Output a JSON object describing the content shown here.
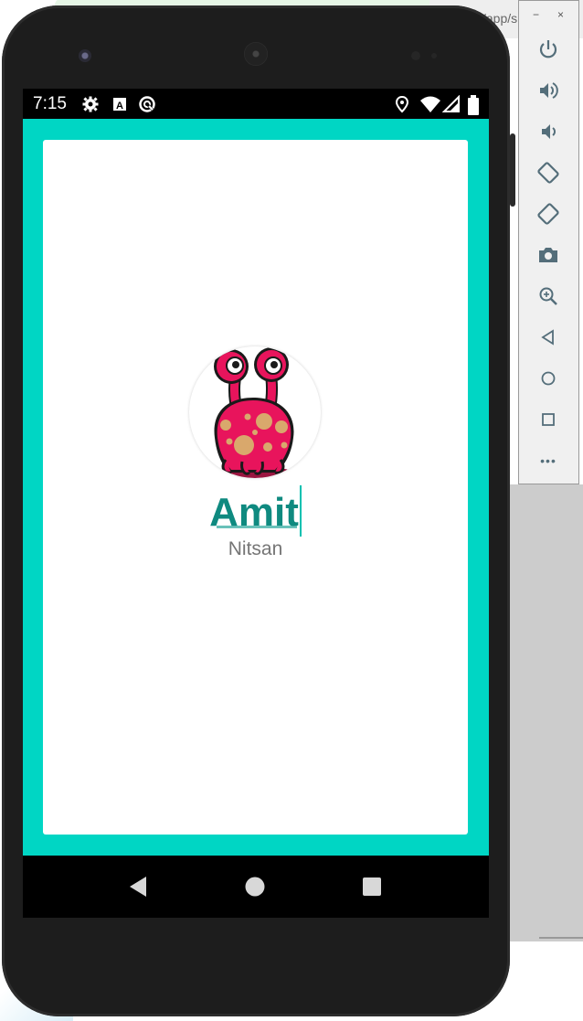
{
  "status_bar": {
    "time": "7:15",
    "left_icons": [
      "gear-icon",
      "font-a-icon",
      "sync-icon"
    ],
    "right_icons": [
      "location-icon",
      "wifi-icon",
      "signal-icon",
      "battery-icon"
    ]
  },
  "card": {
    "first_name": "Amit",
    "last_name": "Nitsan",
    "avatar": "pink-monster-avatar"
  },
  "nav_bar": {
    "buttons": [
      "back",
      "home",
      "recents"
    ]
  },
  "emulator_toolbar": {
    "minimize": "−",
    "close": "×",
    "tools": [
      "power",
      "volume-up",
      "volume-down",
      "rotate-left",
      "rotate-right",
      "screenshot",
      "zoom",
      "back",
      "home",
      "overview",
      "more"
    ],
    "more_label": "•••"
  },
  "colors": {
    "accent": "#00d6c4",
    "name_color": "#0f8a80",
    "surname_color": "#757575",
    "monster": "#e91e63"
  }
}
